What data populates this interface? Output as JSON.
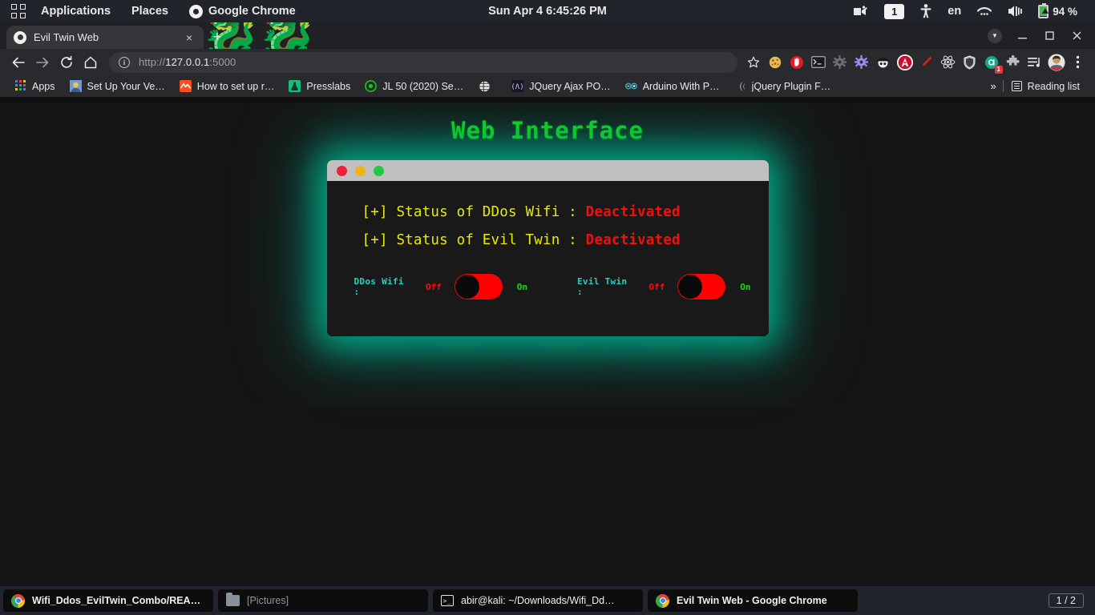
{
  "desktop": {
    "panel": {
      "apps_label": "Applications",
      "places_label": "Places",
      "active_app": "Google Chrome",
      "clock": "Sun Apr 4  6:45:26 PM",
      "workspace_badge": "1",
      "keyboard_layout": "en",
      "battery": "94 %"
    },
    "taskbar": {
      "items": [
        {
          "label": "Wifi_Ddos_EvilTwin_Combo/REA…",
          "icon": "chrome-icon"
        },
        {
          "label": "[Pictures]",
          "icon": "folder-icon"
        },
        {
          "label": "abir@kali: ~/Downloads/Wifi_Dd…",
          "icon": "terminal-icon"
        },
        {
          "label": "Evil Twin Web - Google Chrome",
          "icon": "chrome-icon"
        }
      ],
      "workspace_indicator": "1 / 2"
    }
  },
  "browser": {
    "tab": {
      "title": "Evil Twin Web",
      "close": "×"
    },
    "new_tab": "+",
    "window_controls": {
      "minimize": "–",
      "maximize": "□",
      "close": "×"
    },
    "omnibox": {
      "scheme": "http://",
      "host": "127.0.0.1",
      "port": ":5000",
      "full_url": "http://127.0.0.1:5000"
    },
    "toolbar_icons": [
      "bookmark-star-icon",
      "cookie-icon",
      "stop-hand-icon",
      "terminal-extension-icon",
      "gray-gear-icon",
      "purple-gear-icon",
      "incognito-hat-icon",
      "adblock-icon",
      "red-pen-icon",
      "react-atom-icon",
      "shield-icon",
      "grammar-a-icon",
      "extensions-puzzle-icon",
      "playlist-icon",
      "profile-avatar-icon",
      "chrome-menu-icon"
    ],
    "grammar_badge": "1",
    "bookmarks": {
      "apps_label": "Apps",
      "items": [
        {
          "label": "Set Up Your Ve…",
          "icon": "bookmark-favicon"
        },
        {
          "label": "How to set up r…",
          "icon": "bookmark-favicon"
        },
        {
          "label": "Presslabs",
          "icon": "bookmark-favicon"
        },
        {
          "label": "JL 50 (2020) Se…",
          "icon": "bookmark-favicon"
        },
        {
          "label": "",
          "icon": "globe-favicon"
        },
        {
          "label": "JQuery Ajax PO…",
          "icon": "bookmark-favicon"
        },
        {
          "label": "Arduino With P…",
          "icon": "bookmark-favicon"
        },
        {
          "label": "jQuery Plugin F…",
          "icon": "bookmark-favicon"
        }
      ],
      "overflow": "»",
      "reading_list": "Reading list"
    }
  },
  "page": {
    "title": "Web Interface",
    "accent_green": "#11dd11",
    "glow_color": "#00af8c",
    "terminal": {
      "dots": [
        "#ef1f39",
        "#f0b31c",
        "#22c943"
      ],
      "status_lines": [
        {
          "prefix": "[+] Status of DDos Wifi : ",
          "value": "Deactivated"
        },
        {
          "prefix": "[+] Status of Evil Twin : ",
          "value": "Deactivated"
        }
      ],
      "switches": [
        {
          "label": "DDos Wifi :",
          "off": "Off",
          "on": "On",
          "state": "off",
          "color": "#fe0000"
        },
        {
          "label": "Evil Twin :",
          "off": "Off",
          "on": "On",
          "state": "off",
          "color": "#fe0000"
        }
      ]
    }
  }
}
